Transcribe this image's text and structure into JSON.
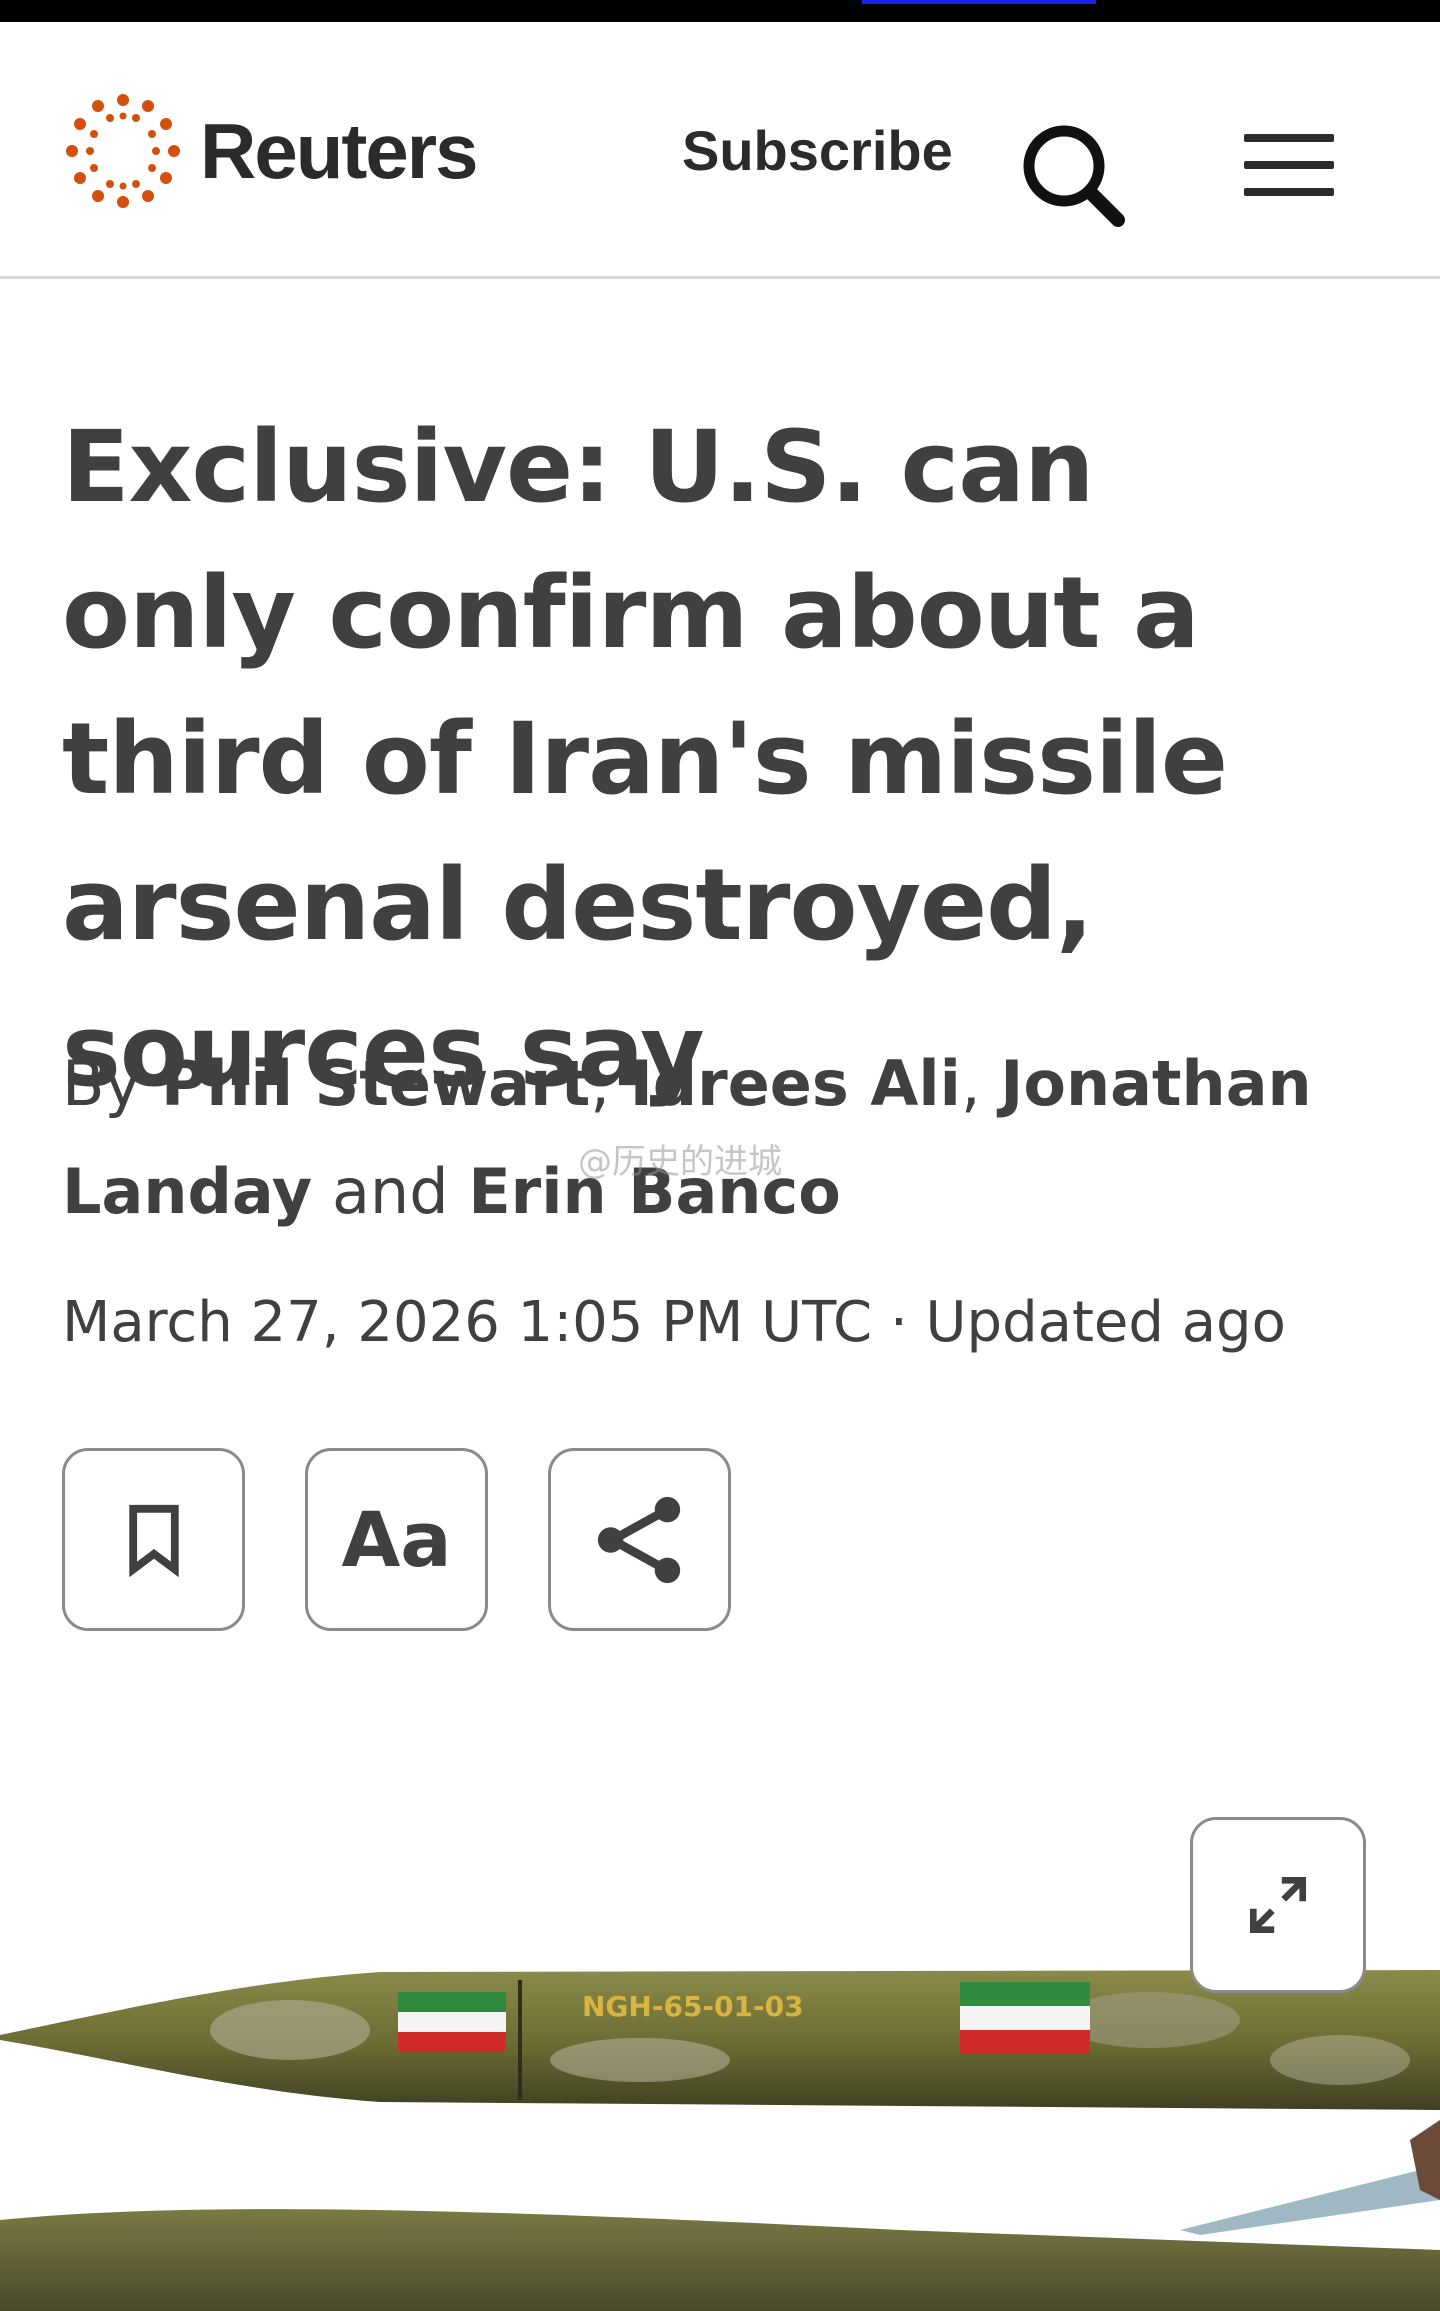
{
  "header": {
    "brand": "Reuters",
    "subscribe_label": "Subscribe",
    "search_icon": "search-icon",
    "menu_icon": "hamburger-menu-icon",
    "accent_color": "#d44f0b"
  },
  "article": {
    "headline": "Exclusive: U.S. can only confirm about a third of Iran's missile arsenal destroyed, sources say",
    "byline": {
      "prefix": "By",
      "author1": "Phil Stewart",
      "sep1": ",",
      "author2": "Idrees Ali",
      "sep2": ",",
      "author3": "Jonathan Landay",
      "conj": "and",
      "author4": "Erin Banco"
    },
    "dateline": "March 27, 2026 1:05 PM UTC · Updated ago",
    "watermark": "@历史的进城"
  },
  "toolbar": {
    "bookmark_icon": "bookmark-icon",
    "text_size_label": "Aa",
    "share_icon": "share-icon"
  },
  "hero_image": {
    "missile_marking": "NGH-65-01-03",
    "expand_icon": "expand-icon"
  }
}
